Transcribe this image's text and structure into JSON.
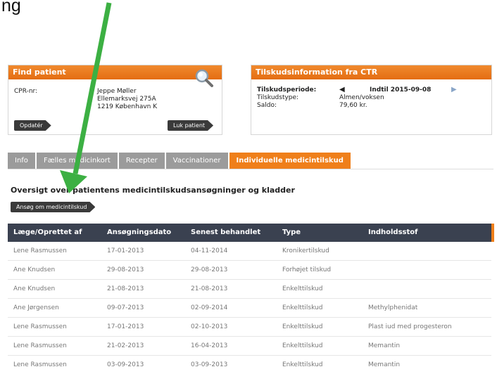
{
  "top_fragment": "ng",
  "find_patient": {
    "title": "Find patient",
    "cpr_label": "CPR-nr:",
    "patient_name": "Jeppe Møller",
    "address_line1": "Ellemarksvej 275A",
    "address_line2": "1219 København K",
    "update_button": "Opdatér",
    "close_button": "Luk patient"
  },
  "tilskud_info": {
    "title": "Tilskudsinformation fra CTR",
    "period_label": "Tilskudsperiode:",
    "period_value": "Indtil 2015-09-08",
    "type_label": "Tilskudstype:",
    "type_value": "Almen/voksen",
    "balance_label": "Saldo:",
    "balance_value": "79,60 kr."
  },
  "tabs": [
    {
      "label": "Info"
    },
    {
      "label": "Fælles medicinkort"
    },
    {
      "label": "Recepter"
    },
    {
      "label": "Vaccinationer"
    },
    {
      "label": "Individuelle medicintilskud",
      "active": true
    }
  ],
  "section_title": "Oversigt over patientens medicintilskudsansøgninger og kladder",
  "apply_button": "Ansøg om medicintilskud",
  "table": {
    "headers": [
      "Læge/Oprettet af",
      "Ansøgningsdato",
      "Senest behandlet",
      "Type",
      "Indholdsstof"
    ],
    "rows": [
      [
        "Lene Rasmussen",
        "17-01-2013",
        "04-11-2014",
        "Kronikertilskud",
        ""
      ],
      [
        "Ane Knudsen",
        "29-08-2013",
        "29-08-2013",
        "Forhøjet tilskud",
        ""
      ],
      [
        "Ane Knudsen",
        "21-08-2013",
        "21-08-2013",
        "Enkelttilskud",
        ""
      ],
      [
        "Ane Jørgensen",
        "09-07-2013",
        "02-09-2014",
        "Enkelttilskud",
        "Methylphenidat"
      ],
      [
        "Lene Rasmussen",
        "17-01-2013",
        "02-10-2013",
        "Enkelttilskud",
        "Plast iud med progesteron"
      ],
      [
        "Lene Rasmussen",
        "21-02-2013",
        "16-04-2013",
        "Enkelttilskud",
        "Memantin"
      ],
      [
        "Lene Rasmussen",
        "03-09-2013",
        "03-09-2013",
        "Enkelttilskud",
        "Memantin"
      ]
    ]
  },
  "colors": {
    "accent_orange": "#ef7f1a",
    "tab_gray": "#9b9b9b",
    "table_header": "#3a4150",
    "annotation_arrow": "#3cb043"
  },
  "icons": [
    "magnifier-icon",
    "triangle-left-icon",
    "triangle-right-icon",
    "annotation-arrow"
  ]
}
